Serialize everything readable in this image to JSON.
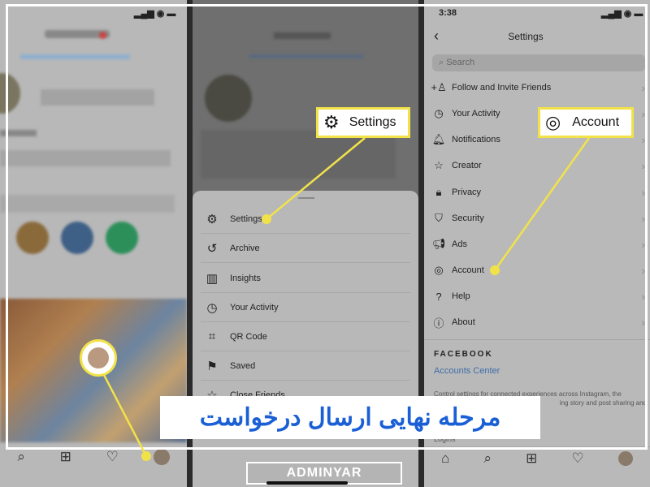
{
  "left_panel": {
    "status_icons": "▂▄▆ ◉ ▬",
    "bottom_nav": [
      "search-icon",
      "add-icon",
      "heart-icon",
      "profile-avatar"
    ]
  },
  "middle_panel": {
    "menu_items": [
      {
        "label": "Settings",
        "icon": "⚙"
      },
      {
        "label": "Archive",
        "icon": "↺"
      },
      {
        "label": "Insights",
        "icon": "▥"
      },
      {
        "label": "Your Activity",
        "icon": "◷"
      },
      {
        "label": "QR Code",
        "icon": "⌗"
      },
      {
        "label": "Saved",
        "icon": "⚑"
      },
      {
        "label": "Close Friends",
        "icon": "☆"
      }
    ]
  },
  "right_panel": {
    "time": "3:38",
    "title": "Settings",
    "search_placeholder": "Search",
    "items": [
      {
        "label": "Follow and Invite Friends",
        "icon": "+♙"
      },
      {
        "label": "Your Activity",
        "icon": "◷"
      },
      {
        "label": "Notifications",
        "icon": "🔔︎"
      },
      {
        "label": "Creator",
        "icon": "☆"
      },
      {
        "label": "Privacy",
        "icon": "🔒︎"
      },
      {
        "label": "Security",
        "icon": "⛉"
      },
      {
        "label": "Ads",
        "icon": "📢︎"
      },
      {
        "label": "Account",
        "icon": "◎"
      },
      {
        "label": "Help",
        "icon": "?"
      },
      {
        "label": "About",
        "icon": "ⓘ"
      }
    ],
    "facebook_heading": "FACEBOOK",
    "accounts_center": "Accounts Center",
    "accounts_desc_1": "Control settings for connected experiences across Instagram, the",
    "accounts_desc_2": "ing story and post sharing and",
    "logins": "Logins"
  },
  "callouts": {
    "settings": "Settings",
    "account": "Account"
  },
  "banner": "مرحله نهایی ارسال درخواست",
  "brand": "ADMINYAR",
  "colors": {
    "highlight": "#f2e24a",
    "banner_text": "#1a5fd6",
    "link": "#3d6ea8"
  }
}
